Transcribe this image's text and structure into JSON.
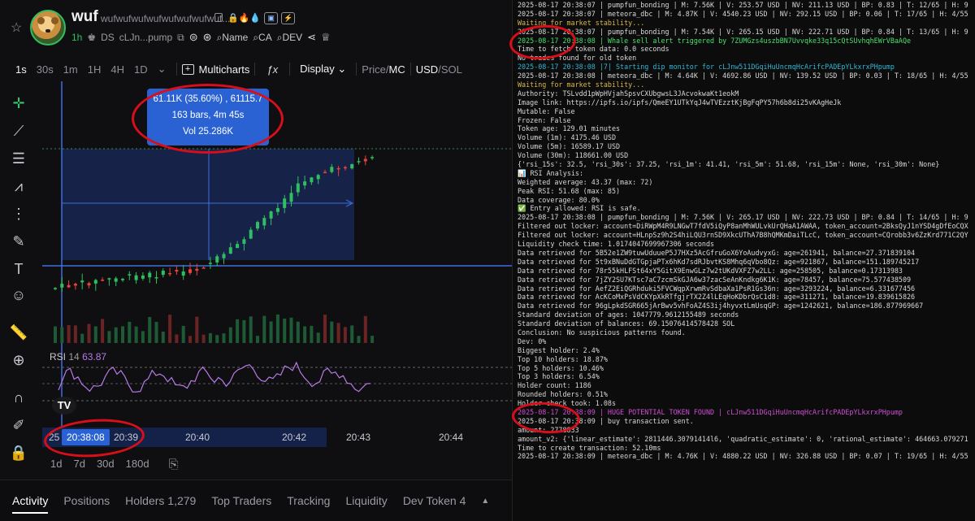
{
  "token": {
    "symbol": "wuf",
    "name": "wufwufwufwufwufwufwufwuf...",
    "age": "1h",
    "ds_label": "DS",
    "address": "cLJn...pump",
    "links": [
      "Name",
      "CA",
      "DEV"
    ]
  },
  "timeframes": [
    "1s",
    "30s",
    "1m",
    "1H",
    "4H",
    "1D"
  ],
  "toolbar": {
    "multicharts": "Multicharts",
    "display": "Display",
    "price_label": "Price",
    "mc_label": "MC",
    "usd_label": "USD",
    "sol_label": "SOL"
  },
  "tooltip": {
    "line1": "61.11K (35.60%) , 61115.7",
    "line2": "163 bars, 4m 45s",
    "line3": "Vol 25.286K"
  },
  "rsi": {
    "label": "RSI",
    "period": "14",
    "value": "63.87"
  },
  "time_axis": {
    "labels": [
      "20:39",
      "20:40",
      "20:42",
      "20:43",
      "20:44"
    ],
    "left_fragment": "25",
    "crosshair_time": "20:38:08"
  },
  "ranges": [
    "1d",
    "7d",
    "30d",
    "180d"
  ],
  "tabs": [
    "Activity",
    "Positions",
    "Holders 1,279",
    "Top Traders",
    "Tracking",
    "Liquidity",
    "Dev Token 4"
  ],
  "terminal": [
    {
      "t": "2025-08-17 20:38:07 | pumpfun_bonding | M: 7.56K | V: 253.57 USD | NV: 211.13 USD | BP: 0.83 | T: 12/65 | H: 9",
      "c": "c-w"
    },
    {
      "t": "2025-08-17 20:38:07 | meteora_dbc | M: 4.87K | V: 4540.23 USD | NV: 292.15 USD | BP: 0.06 | T: 17/65 | H: 4/55",
      "c": "c-w"
    },
    {
      "t": "Waiting for market stability...",
      "c": "c-y"
    },
    {
      "t": "2025-08-17 20:38:07 | pumpfun_bonding | M: 7.54K | V: 265.15 USD | NV: 222.71 USD | BP: 0.84 | T: 13/65 | H: 9",
      "c": "c-w"
    },
    {
      "t": "2025-08-17 20:38:08 | Whale sell alert triggered by 7ZUMGzs4uszbBN7Uvvqke33q15cQtSUvhqhEWrVBaAQe",
      "c": "c-g"
    },
    {
      "t": "Time to fetch token data: 0.0 seconds",
      "c": "c-w"
    },
    {
      "t": "No trades found for old token",
      "c": "c-w"
    },
    {
      "t": "2025-08-17 20:38:08 |7| Starting dip monitor for cLJnw511DGqiHuUncmqHcArifcPADEpYLkxrxPHpump",
      "c": "c-c"
    },
    {
      "t": "2025-08-17 20:38:08 | meteora_dbc | M: 4.64K | V: 4692.86 USD | NV: 139.52 USD | BP: 0.03 | T: 18/65 | H: 4/55",
      "c": "c-w"
    },
    {
      "t": "Waiting for market stability...",
      "c": "c-y"
    },
    {
      "t": "Authority: TSLvdd1pWpHVjahSpsvCXUbgwsL3JAcvokwaKt1eokM",
      "c": "c-w"
    },
    {
      "t": "Image link: https://ipfs.io/ipfs/QmeEY1UTkYqJ4wTVEzztKjBgFqPY57h6b8di25vKAgHeJk",
      "c": "c-w"
    },
    {
      "t": "Mutable: False",
      "c": "c-w"
    },
    {
      "t": "Frozen: False",
      "c": "c-w"
    },
    {
      "t": "Token age: 129.01 minutes",
      "c": "c-w"
    },
    {
      "t": "Volume (1m): 4175.46 USD",
      "c": "c-w"
    },
    {
      "t": "Volume (5m): 16589.17 USD",
      "c": "c-w"
    },
    {
      "t": "Volume (30m): 118661.00 USD",
      "c": "c-w"
    },
    {
      "t": "{'rsi_15s': 32.5, 'rsi_30s': 37.25, 'rsi_1m': 41.41, 'rsi_5m': 51.68, 'rsi_15m': None, 'rsi_30m': None}",
      "c": "c-w"
    },
    {
      "t": "📊 RSI Analysis:",
      "c": "c-w"
    },
    {
      "t": "Weighted average: 43.37 (max: 72)",
      "c": "c-w"
    },
    {
      "t": "Peak RSI: 51.68 (max: 85)",
      "c": "c-w"
    },
    {
      "t": "Data coverage: 80.0%",
      "c": "c-w"
    },
    {
      "t": "✅ Entry allowed: RSI is safe.",
      "c": "c-w"
    },
    {
      "t": "2025-08-17 20:38:08 | pumpfun_bonding | M: 7.56K | V: 265.17 USD | NV: 222.73 USD | BP: 0.84 | T: 14/65 | H: 9",
      "c": "c-w"
    },
    {
      "t": "Filtered out locker: account=DiRWpM4R9LNGwT7fdV5iQyP8anMhWULvkUrQHaA1AWAA, token_account=2BksQyJ1nYSD4gDfEoCQX",
      "c": "c-w"
    },
    {
      "t": "Filtered out locker: account=HLnpSz9h2S4hiLQU3rnSD9XkcUThA7B8hQMKmDaiTLcC, token_account=CQrobb3v6ZzKrd771C2QY",
      "c": "c-w"
    },
    {
      "t": "Liquidity check time: 1.0174047699967306 seconds",
      "c": "c-w"
    },
    {
      "t": "Data retrieved for 5B52e1ZW9tuwUduueP5J7HXz5AcGfruGoX6YoAudvyxG: age=261941, balance=27.371839104",
      "c": "c-w"
    },
    {
      "t": "Data retrieved for 5t9xBNuDdGTGpjaPTx6hKd7sdRJbvtKS8Mhq6qVbo8Qz: age=921867, balance=151.189745217",
      "c": "c-w"
    },
    {
      "t": "Data retrieved for 78r55kHLFSt64xY5GitX9EnwGLz7w2tUKdVXFZ7w2LL: age=258505, balance=0.17313983",
      "c": "c-w"
    },
    {
      "t": "Data retrieved for 7jZY2SU7KTsc7aC7zcmSkGJA6w37zacSeAnKndkg6K1K: age=78457, balance=75.577438509",
      "c": "c-w"
    },
    {
      "t": "Data retrieved for AefZ2EiQGRhduki5FVCWqpXrwmRvSdbaXa1PsR1Gs36n: age=3293224, balance=6.331677456",
      "c": "c-w"
    },
    {
      "t": "Data retrieved for AcKCoMxPsVdCKYpXkRTfgjrTX2Z4lLEqHoKDbrQsC1d8: age=311271, balance=19.839615826",
      "c": "c-w"
    },
    {
      "t": "Data retrieved for 96gLpkdSGR665jArBwv5vhFoAZ4S3ij4hyvxtLmUsqGP: age=1242621, balance=186.877969667",
      "c": "c-w"
    },
    {
      "t": "Standard deviation of ages: 1047779.9612155489 seconds",
      "c": "c-w"
    },
    {
      "t": "Standard deviation of balances: 69.15076414578428 SOL",
      "c": "c-w"
    },
    {
      "t": "Conclusion: No suspicious patterns found.",
      "c": "c-w"
    },
    {
      "t": "Dev: 0%",
      "c": "c-w"
    },
    {
      "t": "Biggest holder: 2.4%",
      "c": "c-w"
    },
    {
      "t": "Top 10 holders: 18.87%",
      "c": "c-w"
    },
    {
      "t": "Top 5 holders: 10.46%",
      "c": "c-w"
    },
    {
      "t": "Top 3 holders: 6.54%",
      "c": "c-w"
    },
    {
      "t": "Holder count: 1186",
      "c": "c-w"
    },
    {
      "t": "Rounded holders: 0.51%",
      "c": "c-w"
    },
    {
      "t": "Holder check took: 1.08s",
      "c": "c-w"
    },
    {
      "t": "2025-08-17 20:38:09 | HUGE POTENTIAL TOKEN FOUND | cLJnw511DGqiHuUncmqHcArifcPADEpYLkxrxPHpump",
      "c": "c-m"
    },
    {
      "t": "2025-08-17 20:38:09 | buy transaction sent.",
      "c": "c-w"
    },
    {
      "t": "amount: 2778833",
      "c": "c-w"
    },
    {
      "t": "amount_v2: {'linear_estimate': 2811446.30791414l6, 'quadratic_estimate': 0, 'rational_estimate': 464663.079271",
      "c": "c-w"
    },
    {
      "t": "Time to create transaction: 52.10ms",
      "c": "c-w"
    },
    {
      "t": "2025-08-17 20:38:09 | meteora_dbc | M: 4.76K | V: 4880.22 USD | NV: 326.88 USD | BP: 0.07 | T: 19/65 | H: 4/55",
      "c": "c-w"
    }
  ],
  "colors": {
    "accent": "#2a62d4",
    "green": "#2fbf60",
    "red": "#e8433c",
    "rsi": "#b77ae6",
    "annotation": "#d80f18"
  }
}
